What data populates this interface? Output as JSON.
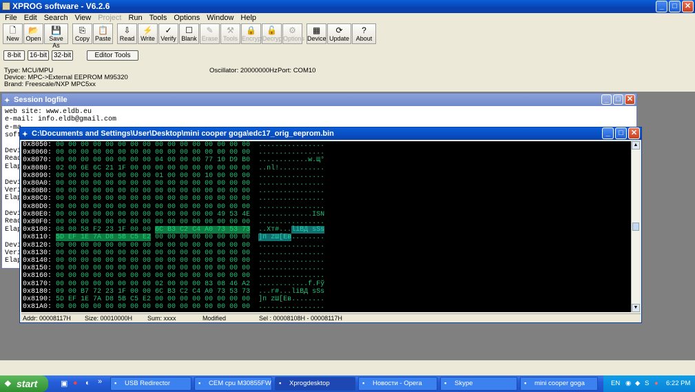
{
  "app": {
    "title": "XPROG software - V6.2.6"
  },
  "menu": [
    {
      "label": "File",
      "enabled": true
    },
    {
      "label": "Edit",
      "enabled": true
    },
    {
      "label": "Search",
      "enabled": true
    },
    {
      "label": "View",
      "enabled": true
    },
    {
      "label": "Project",
      "enabled": false
    },
    {
      "label": "Run",
      "enabled": true
    },
    {
      "label": "Tools",
      "enabled": true
    },
    {
      "label": "Options",
      "enabled": true
    },
    {
      "label": "Window",
      "enabled": true
    },
    {
      "label": "Help",
      "enabled": true
    }
  ],
  "toolbar": [
    {
      "label": "New",
      "icon": "new-file-icon",
      "enabled": true
    },
    {
      "label": "Open",
      "icon": "open-file-icon",
      "enabled": true
    },
    {
      "label": "Save As",
      "icon": "save-as-icon",
      "enabled": true
    },
    {
      "label": "Copy",
      "icon": "copy-icon",
      "enabled": true
    },
    {
      "label": "Paste",
      "icon": "paste-icon",
      "enabled": true
    },
    {
      "label": "Read",
      "icon": "read-icon",
      "enabled": true
    },
    {
      "label": "Write",
      "icon": "write-icon",
      "enabled": true
    },
    {
      "label": "Verify",
      "icon": "verify-icon",
      "enabled": true
    },
    {
      "label": "Blank",
      "icon": "blank-icon",
      "enabled": true
    },
    {
      "label": "Erase",
      "icon": "erase-icon",
      "enabled": false
    },
    {
      "label": "Tools",
      "icon": "tools-icon",
      "enabled": false
    },
    {
      "label": "Encrypt",
      "icon": "encrypt-icon",
      "enabled": false
    },
    {
      "label": "Decrypt",
      "icon": "decrypt-icon",
      "enabled": false
    },
    {
      "label": "Options",
      "icon": "options-icon",
      "enabled": false
    },
    {
      "label": "Device",
      "icon": "device-icon",
      "enabled": true
    },
    {
      "label": "Update",
      "icon": "update-icon",
      "enabled": true
    },
    {
      "label": "About",
      "icon": "about-icon",
      "enabled": true
    }
  ],
  "mode_buttons": {
    "b8": "8-bit",
    "b16": "16-bit",
    "b32": "32-bit",
    "editor": "Editor Tools"
  },
  "device_info": {
    "type": "Type: MCU/MPU",
    "device": "Device: MPC->External EEPROM M95320",
    "brand": "Brand: Freescale/NXP MPC5xx",
    "oscillator": "Oscillator: 20000000Hz",
    "port": "Port: COM10"
  },
  "session": {
    "title": "Session logfile",
    "lines": [
      "web site: www.eldb.eu",
      "e-mail: info.eldb@gmail.com",
      "e-ma",
      "soft",
      "",
      "Devi",
      "Read",
      "Elap",
      "",
      "Devi",
      "Veri",
      "Elap",
      "",
      "Devi",
      "Read",
      "Elap",
      "",
      "Devi",
      "Veri",
      "Elap"
    ]
  },
  "hex_window": {
    "title": "C:\\Documents and Settings\\User\\Desktop\\mini cooper goga\\edc17_orig_eeprom.bin",
    "rows": [
      {
        "addr": "0x8050:",
        "bytes": "00 00 00 00 00 00 00 00 00 00 00 00 00 00 00 00",
        "ascii": "................"
      },
      {
        "addr": "0x8060:",
        "bytes": "00 00 00 00 00 00 00 00 00 00 00 00 00 00 00 00",
        "ascii": "................"
      },
      {
        "addr": "0x8070:",
        "bytes": "00 00 00 00 00 00 00 00 04 00 00 00 77 10 D9 B0",
        "ascii": "............w.Щ°"
      },
      {
        "addr": "0x8080:",
        "bytes": "02 00 6E 6C 21 1F 00 00 00 00 00 00 00 00 00 00",
        "ascii": "..nl!..........."
      },
      {
        "addr": "0x8090:",
        "bytes": "00 00 00 00 00 00 00 00 01 00 00 00 10 00 00 00",
        "ascii": "................"
      },
      {
        "addr": "0x80A0:",
        "bytes": "00 00 00 00 00 00 00 00 00 00 00 00 00 00 00 00",
        "ascii": "................"
      },
      {
        "addr": "0x80B0:",
        "bytes": "00 00 00 00 00 00 00 00 00 00 00 00 00 00 00 00",
        "ascii": "................"
      },
      {
        "addr": "0x80C0:",
        "bytes": "00 00 00 00 00 00 00 00 00 00 00 00 00 00 00 00",
        "ascii": "................"
      },
      {
        "addr": "0x80D0:",
        "bytes": "00 00 00 00 00 00 00 00 00 00 00 00 00 00 00 00",
        "ascii": "................"
      },
      {
        "addr": "0x80E0:",
        "bytes": "00 00 00 00 00 00 00 00 00 00 00 00 00 49 53 4E",
        "ascii": ".............ISN"
      },
      {
        "addr": "0x80F0:",
        "bytes": "00 00 00 00 00 00 00 00 00 00 00 00 00 00 00 00",
        "ascii": "................"
      },
      {
        "addr": "0x8100:",
        "bytes": "08 00 58 F2 23 1F 00 00 6C B3 C2 C4 A0 73 53 73",
        "ascii": "..Xт#...lіВД sSs",
        "sel_from": 8,
        "sel_to": 15
      },
      {
        "addr": "0x8110:",
        "bytes": "5D EF 1E 7A D8 5B C5 E2 00 00 00 00 00 00 00 00",
        "ascii": "]п zШ[Ев........",
        "sel_from": 0,
        "sel_to": 7
      },
      {
        "addr": "0x8120:",
        "bytes": "00 00 00 00 00 00 00 00 00 00 00 00 00 00 00 00",
        "ascii": "................"
      },
      {
        "addr": "0x8130:",
        "bytes": "00 00 00 00 00 00 00 00 00 00 00 00 00 00 00 00",
        "ascii": "................"
      },
      {
        "addr": "0x8140:",
        "bytes": "00 00 00 00 00 00 00 00 00 00 00 00 00 00 00 00",
        "ascii": "................"
      },
      {
        "addr": "0x8150:",
        "bytes": "00 00 00 00 00 00 00 00 00 00 00 00 00 00 00 00",
        "ascii": "................"
      },
      {
        "addr": "0x8160:",
        "bytes": "00 00 00 00 00 00 00 00 00 00 00 00 00 00 00 00",
        "ascii": "................"
      },
      {
        "addr": "0x8170:",
        "bytes": "00 00 00 00 00 00 00 00 02 00 00 00 83 08 46 A2",
        "ascii": "............f.Fў"
      },
      {
        "addr": "0x8180:",
        "bytes": "09 00 B7 72 23 1F 00 00 6C B3 C2 C4 A0 73 53 73",
        "ascii": "...r#...lіВД sSs"
      },
      {
        "addr": "0x8190:",
        "bytes": "5D EF 1E 7A D8 5B C5 E2 00 00 00 00 00 00 00 00",
        "ascii": "]п zШ[Ев........"
      },
      {
        "addr": "0x81A0:",
        "bytes": "00 00 00 00 00 00 00 00 00 00 00 00 00 00 00 00",
        "ascii": "................"
      }
    ],
    "status": {
      "addr": "Addr: 00008117H",
      "size": "Size: 00010000H",
      "sum": "Sum: xxxx",
      "modified": "Modified",
      "sel": "Sel : 00008108H - 00008117H"
    }
  },
  "taskbar": {
    "start": "start",
    "quick": "»",
    "tasks": [
      "USB Redirector",
      "CEM cpu M30855FW ...",
      "Xprogdesktop",
      "Новости - Opera",
      "Skype",
      "mini cooper goga"
    ],
    "active_task": 2,
    "lang": "EN",
    "clock": "6:22 PM"
  },
  "colors": {
    "hex_bg": "#000000",
    "hex_text": "#22c07a",
    "addr_text": "#ffffff",
    "selection": "#19e07a",
    "selection_ascii": "#22e0e0"
  }
}
